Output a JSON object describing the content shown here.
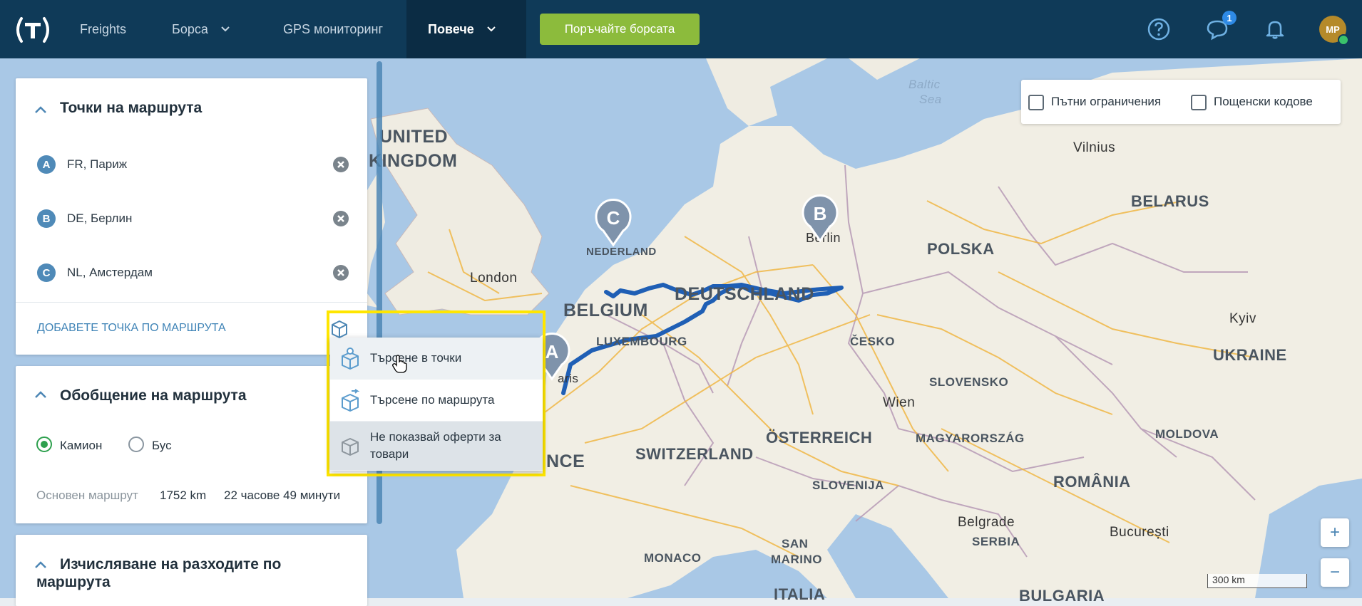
{
  "navbar": {
    "items": [
      {
        "label": "Freights"
      },
      {
        "label": "Борса"
      },
      {
        "label": "GPS мониторинг"
      },
      {
        "label": "Повече"
      }
    ],
    "order_button": "Поръчайте борсата",
    "messages_badge": "1",
    "avatar_initials": "MP"
  },
  "route_points": {
    "title": "Точки на маршрута",
    "points": [
      {
        "letter": "A",
        "text": "FR, Париж"
      },
      {
        "letter": "B",
        "text": "DE, Берлин"
      },
      {
        "letter": "C",
        "text": "NL, Амстердам"
      }
    ],
    "add_link": "ДОБАВЕТЕ ТОЧКА ПО МАРШРУТА"
  },
  "route_summary": {
    "title": "Обобщение на маршрута",
    "vehicle_options": [
      {
        "label": "Камион",
        "selected": true
      },
      {
        "label": "Бус",
        "selected": false
      }
    ],
    "main_route_label": "Основен маршрут",
    "distance": "1752 km",
    "duration": "22 часове 49 минути"
  },
  "cost_calc": {
    "title_line1": "Изчисляване на разходите по",
    "title_line2": "маршрута"
  },
  "dropdown": {
    "items": [
      {
        "label": "Търсене в точки",
        "icon": "box-pin-icon"
      },
      {
        "label": "Търсене по маршрута",
        "icon": "box-route-icon"
      },
      {
        "label": "Не показвай оферти за товари",
        "icon": "box-off-icon"
      }
    ]
  },
  "map_options": {
    "road_restrictions": "Пътни ограничения",
    "postal_codes": "Пощенски кодове"
  },
  "map": {
    "scale_label": "300 km",
    "labels": {
      "uk1": "UNITED",
      "uk2": "KINGDOM",
      "london": "London",
      "baltic1": "Baltic",
      "baltic2": "Sea",
      "vilnius": "Vilnius",
      "belarus": "BELARUS",
      "polska": "POLSKA",
      "berlin": "Berlin",
      "nederland": "NEDERLAND",
      "belgium": "BELGIUM",
      "deutschland": "DEUTSCHLAND",
      "luxembourg": "LUXEMBOURG",
      "cesko": "ČESKO",
      "kyiv": "Kyiv",
      "ukraine": "UKRAINE",
      "slovensko": "SLOVENSKO",
      "wien": "Wien",
      "switzerland": "SWITZERLAND",
      "osterreich": "ÖSTERREICH",
      "magyar": "MAGYARORSZÁG",
      "moldova": "MOLDOVA",
      "romania": "ROMÂNIA",
      "slovenija": "SLOVENIJA",
      "belgrade": "Belgrade",
      "serbia": "SERBIA",
      "bucuresti": "București",
      "monaco": "MONACO",
      "sanmarino1": "SAN",
      "sanmarino2": "MARINO",
      "italia": "ITALIA",
      "paris": "aris",
      "france": "NCE",
      "bulgaria": "BULGARIA"
    },
    "pins": [
      "A",
      "B",
      "C"
    ]
  },
  "colors": {
    "navbar": "#0f3a58",
    "order_button": "#8cbb3c",
    "route_line": "#1f5fb5",
    "pin": "#7f93ab",
    "highlight": "#ffe600"
  }
}
